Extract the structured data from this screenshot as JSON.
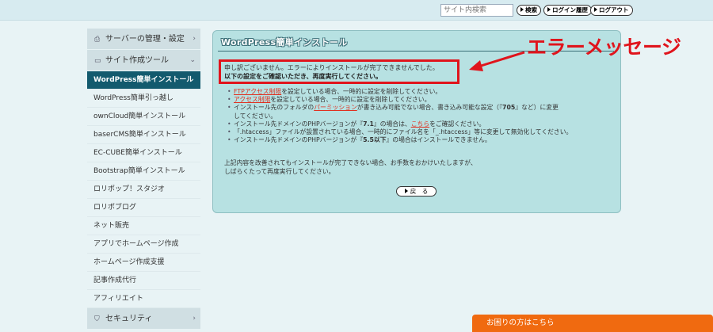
{
  "header": {
    "search_placeholder": "サイト内検索",
    "search_button": "検索",
    "login_history_button": "ログイン履歴",
    "logout_button": "ログアウト"
  },
  "sidebar": {
    "sections": [
      {
        "label": "サーバーの管理・設定",
        "icon": "printer-icon"
      },
      {
        "label": "サイト作成ツール",
        "icon": "monitor-icon"
      }
    ],
    "items": [
      {
        "label": "WordPress簡単インストール",
        "active": true
      },
      {
        "label": "WordPress簡単引っ越し"
      },
      {
        "label": "ownCloud簡単インストール"
      },
      {
        "label": "baserCMS簡単インストール"
      },
      {
        "label": "EC-CUBE簡単インストール"
      },
      {
        "label": "Bootstrap簡単インストール"
      },
      {
        "label": "ロリポップ！スタジオ"
      },
      {
        "label": "ロリポブログ"
      },
      {
        "label": "ネット販売"
      },
      {
        "label": "アプリでホームページ作成"
      },
      {
        "label": "ホームページ作成支援"
      },
      {
        "label": "記事作成代行"
      },
      {
        "label": "アフィリエイト"
      }
    ],
    "bottom_section": {
      "label": "セキュリティ",
      "icon": "shield-icon"
    }
  },
  "panel": {
    "title": "WordPress簡単インストール",
    "error_line1": "申し訳ございません。エラーによりインストールが完了できませんでした。",
    "error_line2": "以下の設定をご確認いただき、再度実行してください。",
    "bullets": {
      "b1_link": "FTPアクセス制限",
      "b1_text": "を設定している場合、一時的に設定を削除してください。",
      "b2_link": "アクセス制限",
      "b2_text": "を設定している場合、一時的に設定を削除してください。",
      "b3_pre": "インストール先のフォルダの",
      "b3_link": "パーミッション",
      "b3_mid": "が書き込み可能でない場合、書き込み可能な設定（『",
      "b3_bold": "705",
      "b3_post": "』など）に変更",
      "b3_cont": "してください。",
      "b4_pre": "インストール先ドメインのPHPバージョンが『",
      "b4_bold": "7.1",
      "b4_mid": "』の場合は、",
      "b4_link": "こちら",
      "b4_post": "をご確認ください。",
      "b5_text": "「.htaccess」ファイルが設置されている場合、一時的にファイル名を「_.htaccess」等に変更して無効化してください。",
      "b6_pre": "インストール先ドメインのPHPバージョンが『",
      "b6_bold": "5.5以下",
      "b6_post": "』の場合はインストールできません。"
    },
    "paragraph_line1": "上記内容を改善されてもインストールが完了できない場合、お手数をおかけいたしますが、",
    "paragraph_line2": "しばらくたって再度実行してください。",
    "back_button": "戻　る"
  },
  "annotation": {
    "label": "エラーメッセージ",
    "color": "#e0141c"
  },
  "help_bar": {
    "label": "お困りの方はこちら",
    "color": "#f06a10"
  }
}
